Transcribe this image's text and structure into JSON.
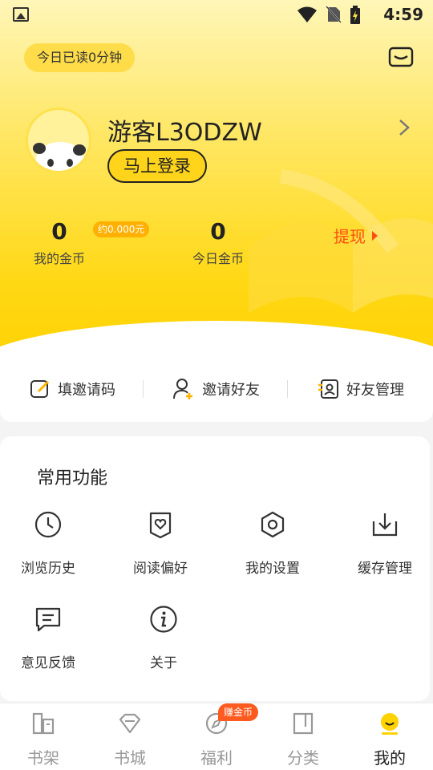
{
  "status_bar": {
    "time": "4:59"
  },
  "header": {
    "read_today": "今日已读0分钟"
  },
  "profile": {
    "username": "游客L3ODZW",
    "login_label": "马上登录"
  },
  "stats": {
    "my_coins_value": "0",
    "my_coins_label": "我的金币",
    "coin_estimate": "约0.000元",
    "today_coins_value": "0",
    "today_coins_label": "今日金币",
    "withdraw_label": "提现"
  },
  "invite": {
    "items": [
      {
        "label": "填邀请码"
      },
      {
        "label": "邀请好友"
      },
      {
        "label": "好友管理"
      }
    ]
  },
  "common": {
    "title": "常用功能",
    "items": [
      {
        "label": "浏览历史"
      },
      {
        "label": "阅读偏好"
      },
      {
        "label": "我的设置"
      },
      {
        "label": "缓存管理"
      },
      {
        "label": "意见反馈"
      },
      {
        "label": "关于"
      }
    ]
  },
  "tabbar": {
    "items": [
      {
        "label": "书架"
      },
      {
        "label": "书城"
      },
      {
        "label": "福利"
      },
      {
        "label": "分类"
      },
      {
        "label": "我的"
      }
    ],
    "active": "我的",
    "earn_badge": "赚金币"
  },
  "colors": {
    "accent": "#ffd200",
    "withdraw": "#ff4d12",
    "badge": "#ff5a1f"
  }
}
